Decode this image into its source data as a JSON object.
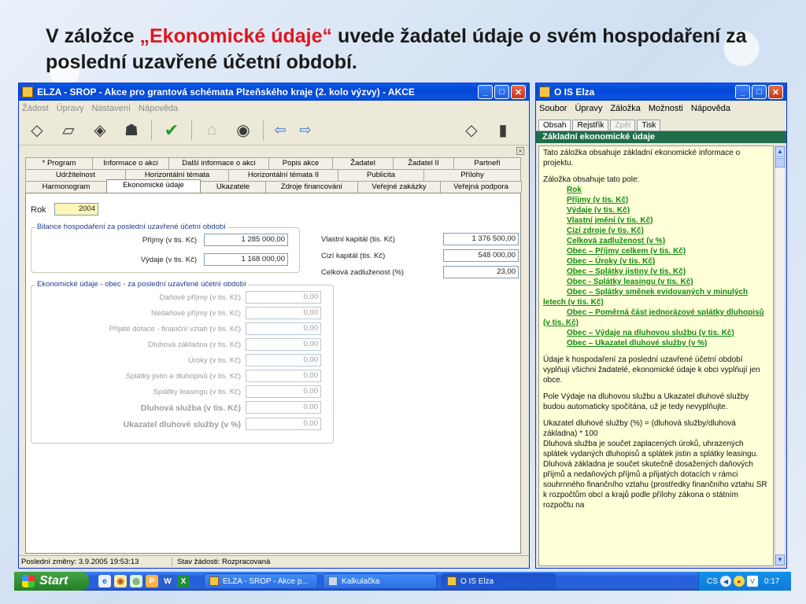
{
  "slide": {
    "title_pre": "V záložce ",
    "title_highlight": "„Ekonomické údaje“",
    "title_post": " uvede žadatel údaje o svém hospodaření za poslední uzavřené účetní období."
  },
  "elza": {
    "title": "ELZA - SROP - Akce pro grantová schémata Plzeňského kraje (2. kolo výzvy) - AKCE",
    "menu": [
      "Žádost",
      "Úpravy",
      "Nastavení",
      "Nápověda"
    ],
    "tabs_row1": [
      "* Program",
      "Informace o akci",
      "Další informace o akci",
      "Popis akce",
      "Žadatel",
      "Žadatel II",
      "Partneři"
    ],
    "tabs_row2": [
      "Udržitelnost",
      "Horizontální témata",
      "Horizontální témata II",
      "Publicita",
      "Přílohy"
    ],
    "tabs_row3": [
      "Harmonogram",
      "Ekonomické údaje",
      "Ukazatele",
      "Zdroje financování",
      "Veřejné zakázky",
      "Veřejná podpora"
    ],
    "rok_label": "Rok",
    "rok_value": "2004",
    "bilance": {
      "title": "Bilance hospodaření za poslední uzavřené účetní období",
      "prijmy_label": "Příjmy (v tis. Kč)",
      "prijmy_value": "1 285 000,00",
      "vydaje_label": "Výdaje (v tis. Kč)",
      "vydaje_value": "1 168 000,00"
    },
    "right_fields": {
      "vlastni_label": "Vlastní kapitál (tis. Kč)",
      "vlastni_value": "1 376 500,00",
      "cizi_label": "Cizí kapitál (tis. Kč)",
      "cizi_value": "548 000,00",
      "zadluzenost_label": "Celková zadluženost (%)",
      "zadluzenost_value": "23,00"
    },
    "obec": {
      "title": "Ekonomické údaje - obec - za poslední uzavřené účetní období",
      "rows": [
        {
          "label": "Daňové příjmy (v tis. Kč)",
          "value": "0,00"
        },
        {
          "label": "Nedaňové příjmy (v tis. Kč)",
          "value": "0,00"
        },
        {
          "label": "Přijaté dotace - finanční vztah (v tis. Kč)",
          "value": "0,00"
        },
        {
          "label": "Dluhová základna (v tis. Kč)",
          "value": "0,00"
        },
        {
          "label": "Úroky (v tis. Kč)",
          "value": "0,00"
        },
        {
          "label": "Splátky jistin a dluhopisů (v tis. Kč)",
          "value": "0,00"
        },
        {
          "label": "Splátky leasingu (v tis. Kč)",
          "value": "0,00"
        },
        {
          "label": "Dluhová služba (v tis. Kč)",
          "value": "0,00"
        },
        {
          "label": "Ukazatel dluhové služby (v %)",
          "value": "0,00"
        }
      ]
    },
    "status": {
      "last_change": "Poslední změny: 3.9.2005 19:53:13",
      "state": "Stav žádosti: Rozpracovaná"
    }
  },
  "help": {
    "title": "O IS Elza",
    "menu": [
      "Soubor",
      "Úpravy",
      "Záložka",
      "Možnosti",
      "Nápověda"
    ],
    "tabs": [
      "Obsah",
      "Rejstřík",
      "Zpět",
      "Tisk"
    ],
    "heading": "Základní ekonomické údaje",
    "intro": "Tato záložka obsahuje základní ekonomické informace o projektu.",
    "fields_intro": "Záložka obsahuje tato pole:",
    "links": [
      "Rok",
      "Příjmy (v tis. Kč)",
      "Výdaje (v tis. Kč)",
      "Vlastní jmění (v tis. Kč)",
      "Cizí zdroje (v tis. Kč)",
      "Celková zadluženost (v %)",
      "Obec – Příjmy celkem (v tis. Kč)",
      "Obec – Úroky (v tis. Kč)",
      "Obec – Splátky jistiny (v tis. Kč)",
      "Obec - Splátky leasingu (v tis. Kč)",
      "Obec – Splátky směnek evidovaných v minulých letech (v tis. Kč)",
      "Obec – Poměrná část jednorázové splátky dluhopisů (v tis. Kč)",
      "Obec – Výdaje na dluhovou službu (v tis. Kč)",
      "Obec – Ukazatel dluhové služby (v %)"
    ],
    "para1": "Údaje k hospodaření za poslední uzavřené účetní období vyplňují všichni žadatelé, ekonomické údaje k obci vyplňují jen obce.",
    "para2": "Pole Výdaje na dluhovou službu a Ukazatel dluhové služby budou automaticky spočítána, už je tedy nevyplňujte.",
    "para3": "Ukazatel dluhové služby (%) = (dluhová služby/dluhová základna) * 100",
    "para4": "Dluhová služba je součet zaplacených úroků, uhrazených splátek vydaných dluhopisů a splátek jistin a splátky leasingu. Dluhová základna je součet skutečně dosažených daňových příjmů a nedaňových příjmů a přijatých dotacích v rámci souhrnného finančního vztahu (prostředky finančního vztahu SR k rozpočtům obcí a krajů podle přílohy zákona o státním rozpočtu na"
  },
  "taskbar": {
    "start": "Start",
    "buttons": [
      "ELZA - SROP - Akce p...",
      "Kalkulačka",
      "O IS Elza"
    ],
    "lang": "CS",
    "clock": "0:17"
  }
}
